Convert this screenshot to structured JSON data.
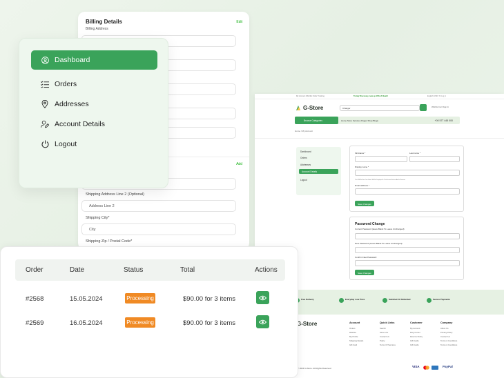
{
  "billing": {
    "title": "Billing Details",
    "subtitle": "Billing Address",
    "edit": "Edit",
    "add": "Add",
    "labels": [
      "Shipping Address Line 2 (Optional)",
      "Shipping City*",
      "Shipping Zip / Postal Code*"
    ],
    "fields": [
      "Address Line 2",
      "City"
    ]
  },
  "sidebar": {
    "items": [
      {
        "label": "Dashboard",
        "icon": "user-icon",
        "active": true
      },
      {
        "label": "Orders",
        "icon": "list-icon"
      },
      {
        "label": "Addresses",
        "icon": "location-icon"
      },
      {
        "label": "Account Details",
        "icon": "user-edit-icon"
      },
      {
        "label": "Logout",
        "icon": "power-icon"
      }
    ]
  },
  "store": {
    "topbar": {
      "left": "My Account   Wishlist   Order Tracking",
      "promo": "Trendy Discovery, now up 10% off deals!",
      "right": "English    USD    f  X  in  ig  yt"
    },
    "logo": "G-Store",
    "search_value": "Changer",
    "header_icons": "Wishlist   Cart   Sign In",
    "categories": "Browse Categories",
    "nav": "Home   Store   Services   Pages   Shop   Blogs",
    "phone": "+00 577 445 000",
    "breadcrumb": "Home  /  My Account",
    "side": [
      "Dashboard",
      "Orders",
      "Addresses",
      "Account Details",
      "Logout"
    ],
    "form": {
      "first": "Firstname *",
      "last": "Last name *",
      "display": "Display name *",
      "hint": "This Will Be How Your Name Will Be Displayed In The Account Section And In Reviews",
      "email": "Email address *",
      "save": "Save Changes"
    },
    "pw": {
      "title": "Password Change",
      "current": "Current Password (leave Blank To Leave Unchanged)",
      "new": "New Password (Leave Blank To Leave Unchanged)",
      "confirm": "Confirm New Password",
      "save": "Save Changes"
    },
    "features": [
      "Free Delivery",
      "Everyday Low Price",
      "Satisfied Or Refunded",
      "Secure Payments"
    ],
    "footer_cols": [
      "Account",
      "Quick Links",
      "Customer",
      "Company"
    ],
    "footer_links": [
      [
        "Orders",
        "Wishlist",
        "My Profile",
        "Shipping Details",
        "Gift Card"
      ],
      [
        "Search",
        "Store Info",
        "Contact Us",
        "Policy",
        "Terms Of Services"
      ],
      [
        "My Account",
        "FAQ Center",
        "Returns Policy",
        "Gift Cards",
        "Gift Cards"
      ],
      [
        "About Us",
        "Privacy Policy",
        "Contact Us",
        "Terms & Conditions",
        "Terms & Conditions"
      ]
    ],
    "copyright": "Copyright © 2024 G-Store. All Rights Reserved",
    "payments": [
      "VISA",
      "PayPal"
    ]
  },
  "orders": {
    "headers": [
      "Order",
      "Date",
      "Status",
      "Total",
      "Actions"
    ],
    "rows": [
      {
        "order": "#2568",
        "date": "15.05.2024",
        "status": "Processing",
        "total": "$90.00 for 3 items"
      },
      {
        "order": "#2569",
        "date": "16.05.2024",
        "status": "Processing",
        "total": "$90.00 for 3 items"
      }
    ]
  },
  "colors": {
    "accent": "#3aa35a",
    "status": "#f08a24",
    "sidebar_bg": "#eef7ee"
  }
}
